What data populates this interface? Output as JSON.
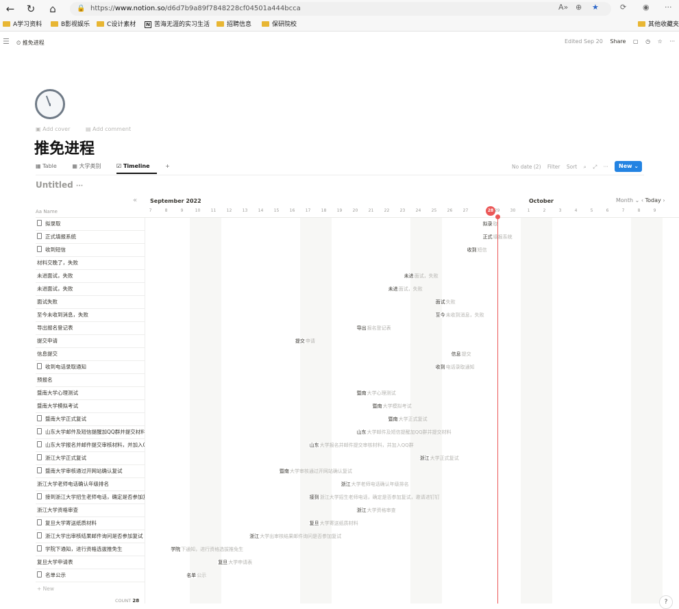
{
  "browser": {
    "url_prefix": "https://",
    "url_host": "www.notion.so",
    "url_path": "/d6d7b9a89f7848228cf04501a444bcca",
    "bookmarks": [
      "A学习资料",
      "B影视娱乐",
      "C设计素材",
      "苦海无涯的实习生活",
      "招聘信息",
      "保研院校"
    ],
    "other_bookmarks": "其他收藏夹"
  },
  "topbar": {
    "breadcrumb": "推免进程",
    "edited": "Edited Sep 20",
    "share": "Share"
  },
  "page": {
    "add_cover": "Add cover",
    "add_comment": "Add comment",
    "title": "推免进程"
  },
  "views": {
    "tabs": [
      "Table",
      "大学类别",
      "Timeline"
    ],
    "active": "Timeline",
    "no_date": "No date (2)",
    "filter": "Filter",
    "sort": "Sort",
    "new_label": "New"
  },
  "database_title": "Untitled",
  "timeline": {
    "month_1": "September 2022",
    "month_2": "October",
    "scale": "Month",
    "today_btn": "Today",
    "days": [
      "7",
      "8",
      "9",
      "10",
      "11",
      "12",
      "13",
      "14",
      "15",
      "16",
      "17",
      "18",
      "19",
      "20",
      "21",
      "22",
      "23",
      "24",
      "25",
      "26",
      "27",
      "28",
      "29",
      "30",
      "1",
      "2",
      "3",
      "4",
      "5",
      "6",
      "7",
      "8",
      "9"
    ],
    "today_index": 21,
    "weekend_indices": [
      3,
      4,
      10,
      11,
      17,
      18,
      24,
      25,
      31,
      32
    ],
    "name_header": "Name"
  },
  "rows": [
    {
      "name": "拟录取",
      "doc": true,
      "start": 21.2,
      "lbl": "拟录",
      "rest": "取"
    },
    {
      "name": "正式填报系统",
      "doc": true,
      "start": 21.2,
      "lbl": "正式",
      "rest": "填报系统"
    },
    {
      "name": "收到短信",
      "doc": true,
      "start": 20.2,
      "lbl": "收到",
      "rest": "短信"
    },
    {
      "name": "材料交晚了，失败",
      "doc": false,
      "start": null,
      "lbl": "",
      "rest": ""
    },
    {
      "name": "未进面试，失败",
      "doc": false,
      "start": 16.2,
      "lbl": "未进",
      "rest": "面试，失败"
    },
    {
      "name": "未进面试，失败",
      "doc": false,
      "start": 15.2,
      "lbl": "未进",
      "rest": "面试，失败"
    },
    {
      "name": "面试失败",
      "doc": false,
      "start": 18.2,
      "lbl": "面试",
      "rest": "失败"
    },
    {
      "name": "至今未收到消息，失败",
      "doc": false,
      "start": 18.2,
      "lbl": "至今",
      "rest": "未收到消息，失败"
    },
    {
      "name": "导出报名登记表",
      "doc": false,
      "start": 13.2,
      "lbl": "导出",
      "rest": "报名登记表"
    },
    {
      "name": "提交申请",
      "doc": false,
      "start": 9.3,
      "lbl": "提交",
      "rest": "申请"
    },
    {
      "name": "信息提交",
      "doc": false,
      "start": 19.2,
      "lbl": "信息",
      "rest": "提交"
    },
    {
      "name": "收到电话录取通知",
      "doc": true,
      "start": 18.2,
      "lbl": "收到",
      "rest": "电话录取通知"
    },
    {
      "name": "预报名",
      "doc": false,
      "start": null,
      "lbl": "",
      "rest": ""
    },
    {
      "name": "暨南大学心理测试",
      "doc": false,
      "start": 13.2,
      "lbl": "暨南",
      "rest": "大学心理测试"
    },
    {
      "name": "暨南大学模拟考试",
      "doc": false,
      "start": 14.2,
      "lbl": "暨南",
      "rest": "大学模拟考试"
    },
    {
      "name": "暨南大学正式复试",
      "doc": true,
      "start": 15.2,
      "lbl": "暨南",
      "rest": "大学正式复试"
    },
    {
      "name": "山东大学邮件及短信提醒加QQ群并提交材料",
      "doc": true,
      "start": 13.2,
      "lbl": "山东",
      "rest": "大学邮件及短信提醒加QQ群并提交材料"
    },
    {
      "name": "山东大学报名并邮件提交审核材料，并加入QQ群",
      "doc": true,
      "start": 10.2,
      "lbl": "山东",
      "rest": "大学报名并邮件提交审核材料，并加入QQ群"
    },
    {
      "name": "浙江大学正式复试",
      "doc": true,
      "start": 17.2,
      "lbl": "浙江",
      "rest": "大学正式复试"
    },
    {
      "name": "暨南大学审核通过开网站确认复试",
      "doc": true,
      "start": 8.3,
      "lbl": "暨南",
      "rest": "大学审核通过开网站确认复试"
    },
    {
      "name": "浙江大学老师电话确认年级排名",
      "doc": false,
      "start": 12.2,
      "lbl": "浙江",
      "rest": "大学老师电话确认年级排名"
    },
    {
      "name": "接到浙江大学招生老师电话，确定是否参加复试，邀请进钉钉",
      "doc": true,
      "start": 10.2,
      "lbl": "接到",
      "rest": "浙江大学招生老师电话，确定是否参加复试，邀请进钉钉"
    },
    {
      "name": "浙江大学资格审查",
      "doc": false,
      "start": 13.2,
      "lbl": "浙江",
      "rest": "大学资格审查"
    },
    {
      "name": "复旦大学寄送纸质材料",
      "doc": true,
      "start": 10.2,
      "lbl": "复旦",
      "rest": "大学寄送纸质材料"
    },
    {
      "name": "浙江大学出审核结果邮件询问是否参加复试",
      "doc": true,
      "start": 6.4,
      "lbl": "浙江",
      "rest": "大学出审核结果邮件询问是否参加复试"
    },
    {
      "name": "学院下通知，进行资格选拔推免生",
      "doc": true,
      "start": 1.4,
      "lbl": "学院",
      "rest": "下通知，进行资格选拔推免生"
    },
    {
      "name": "复旦大学申请表",
      "doc": false,
      "start": 4.4,
      "lbl": "复旦",
      "rest": "大学申请表"
    },
    {
      "name": "名单公示",
      "doc": true,
      "start": 2.4,
      "lbl": "名单",
      "rest": "公示"
    }
  ],
  "footer": {
    "new_row": "+ New",
    "count_label": "COUNT",
    "count_value": "28",
    "help": "?"
  }
}
